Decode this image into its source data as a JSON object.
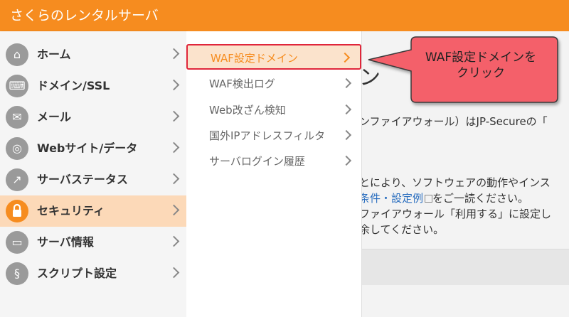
{
  "header": {
    "title": "さくらのレンタルサーバ"
  },
  "sidebar": {
    "items": [
      {
        "label": "ホーム",
        "icon": "home-icon",
        "glyph": "⌂"
      },
      {
        "label": "ドメイン/SSL",
        "icon": "keyboard-icon",
        "glyph": "⌨"
      },
      {
        "label": "メール",
        "icon": "mail-icon",
        "glyph": "✉"
      },
      {
        "label": "Webサイト/データ",
        "icon": "globe-icon",
        "glyph": "◎"
      },
      {
        "label": "サーバステータス",
        "icon": "chart-icon",
        "glyph": "↗"
      },
      {
        "label": "セキュリティ",
        "icon": "lock-icon",
        "glyph": "🔒",
        "active": true
      },
      {
        "label": "サーバ情報",
        "icon": "server-icon",
        "glyph": "▭"
      },
      {
        "label": "スクリプト設定",
        "icon": "script-file-icon",
        "glyph": "§"
      }
    ]
  },
  "submenu": {
    "items": [
      {
        "label": "WAF設定ドメイン",
        "active": true
      },
      {
        "label": "WAF検出ログ"
      },
      {
        "label": "Web改ざん検知"
      },
      {
        "label": "国外IPアドレスフィルタ"
      },
      {
        "label": "サーバログイン履歴"
      }
    ]
  },
  "page": {
    "title_fragment": "ン",
    "line1": "ンファイアウォール）はJP-Secureの「",
    "line2": "とにより、ソフトウェアの動作やインス",
    "line3_link": "条件・設定例",
    "line3_rest": "をご一読ください。",
    "line4": "ファイアウォール「利用する」に設定し",
    "line5": "余してください。"
  },
  "callout": {
    "line1": "WAF設定ドメインを",
    "line2": "クリック",
    "fill": "#f4606a",
    "border": "#3a3a3a"
  },
  "colors": {
    "brand": "#f68c1f",
    "highlight_border": "#e0263b",
    "active_bg": "#fcd9b8"
  }
}
